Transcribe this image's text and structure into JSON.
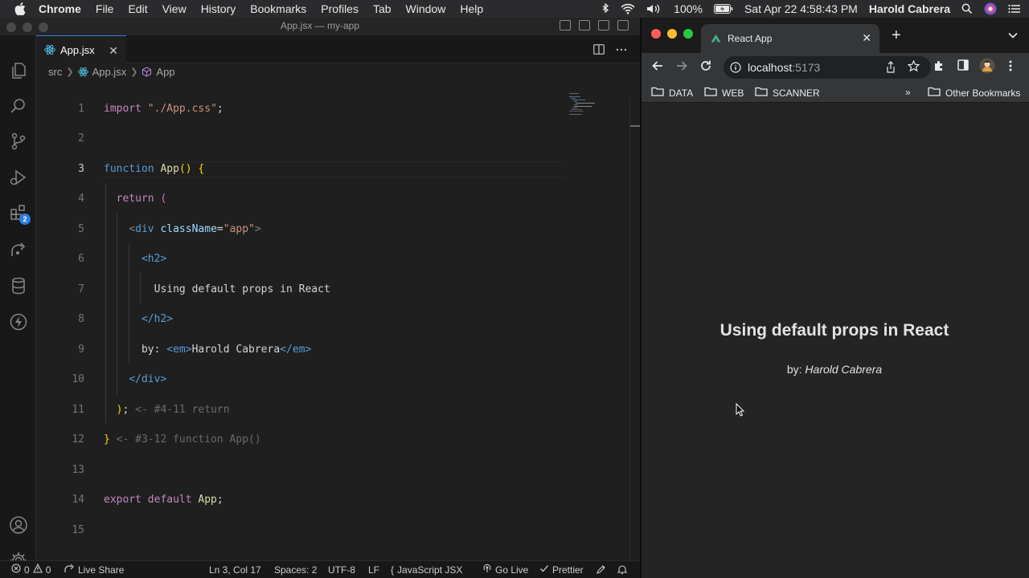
{
  "menubar": {
    "app": "Chrome",
    "items": [
      "File",
      "Edit",
      "View",
      "History",
      "Bookmarks",
      "Profiles",
      "Tab",
      "Window",
      "Help"
    ],
    "battery": "100%",
    "datetime": "Sat Apr 22  4:58:43 PM",
    "user": "Harold Cabrera"
  },
  "vscode": {
    "window_title": "App.jsx — my-app",
    "tab_label": "App.jsx",
    "tab_close": "✕",
    "breadcrumb": [
      "src",
      "App.jsx",
      "App"
    ],
    "extensions_badge": "2",
    "line_numbers": [
      "1",
      "2",
      "3",
      "4",
      "5",
      "6",
      "7",
      "8",
      "9",
      "10",
      "11",
      "12",
      "13",
      "14",
      "15"
    ],
    "code": {
      "l1_kw": "import",
      "l1_str": "\"./App.css\"",
      "l1_end": ";",
      "l3_kw": "function",
      "l3_fn": "App",
      "l3_paren": "()",
      "l3_brace": "{",
      "l4_kw": "return",
      "l4_paren": "(",
      "l5_open": "<",
      "l5_tag": "div",
      "l5_attr": "className",
      "l5_eq": "=",
      "l5_str": "\"app\"",
      "l5_close": ">",
      "l6_tag": "<h2>",
      "l7_text": "Using default props in React",
      "l8_tag": "</h2>",
      "l9_text": "by: ",
      "l9_open": "<em>",
      "l9_name": "Harold Cabrera",
      "l9_close": "</em>",
      "l10_tag": "</div>",
      "l11_paren": ")",
      "l11_semi": ";",
      "l11_cmt": " <- #4-11 return",
      "l12_brace": "}",
      "l12_cmt": " <- #3-12 function App()",
      "l14_kw": "export default",
      "l14_fn": "App",
      "l14_end": ";"
    },
    "status": {
      "errors": "0",
      "warnings": "0",
      "live_share": "Live Share",
      "position": "Ln 3, Col 17",
      "spaces": "Spaces: 2",
      "encoding": "UTF-8",
      "eol": "LF",
      "language": "JavaScript JSX",
      "go_live": "Go Live",
      "prettier": "Prettier"
    }
  },
  "chrome": {
    "tab_title": "React App",
    "url_host": "localhost",
    "url_port": ":5173",
    "bookmarks": [
      "DATA",
      "WEB",
      "SCANNER"
    ],
    "bookmarks_overflow": "»",
    "other_bookmarks": "Other Bookmarks",
    "page": {
      "heading": "Using default props in React",
      "by_prefix": "by: ",
      "by_name": "Harold Cabrera"
    }
  },
  "colors": {
    "vscode_bg": "#1f1f1f",
    "accent": "#2f7de1",
    "keyword": "#569cd6",
    "control": "#c586c0",
    "string": "#ce9178",
    "function": "#dcdcaa"
  }
}
